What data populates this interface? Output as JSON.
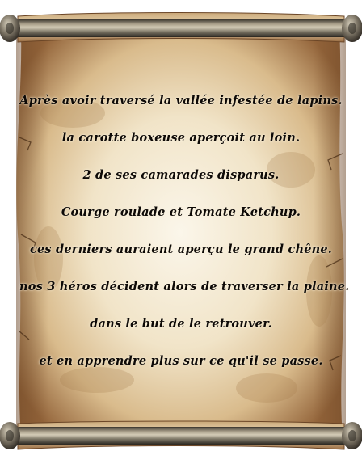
{
  "scroll": {
    "colors": {
      "parchment_light": "#f7efdd",
      "parchment_mid": "#e3cda6",
      "parchment_dark": "#8a5d35",
      "rod_dark": "#2e2a24",
      "rod_mid": "#6e685c",
      "rod_light": "#b7ad98",
      "text": "#0d0906"
    },
    "lines": [
      "Après avoir traversé la vallée infestée de lapins.",
      "la carotte boxeuse aperçoit au loin.",
      "2 de ses camarades disparus.",
      "Courge roulade et Tomate Ketchup.",
      "ces derniers auraient aperçu le grand chêne.",
      "nos 3 héros décident alors de traverser la plaine.",
      "dans le but de le retrouver.",
      "et en apprendre plus sur ce qu'il se passe."
    ]
  }
}
